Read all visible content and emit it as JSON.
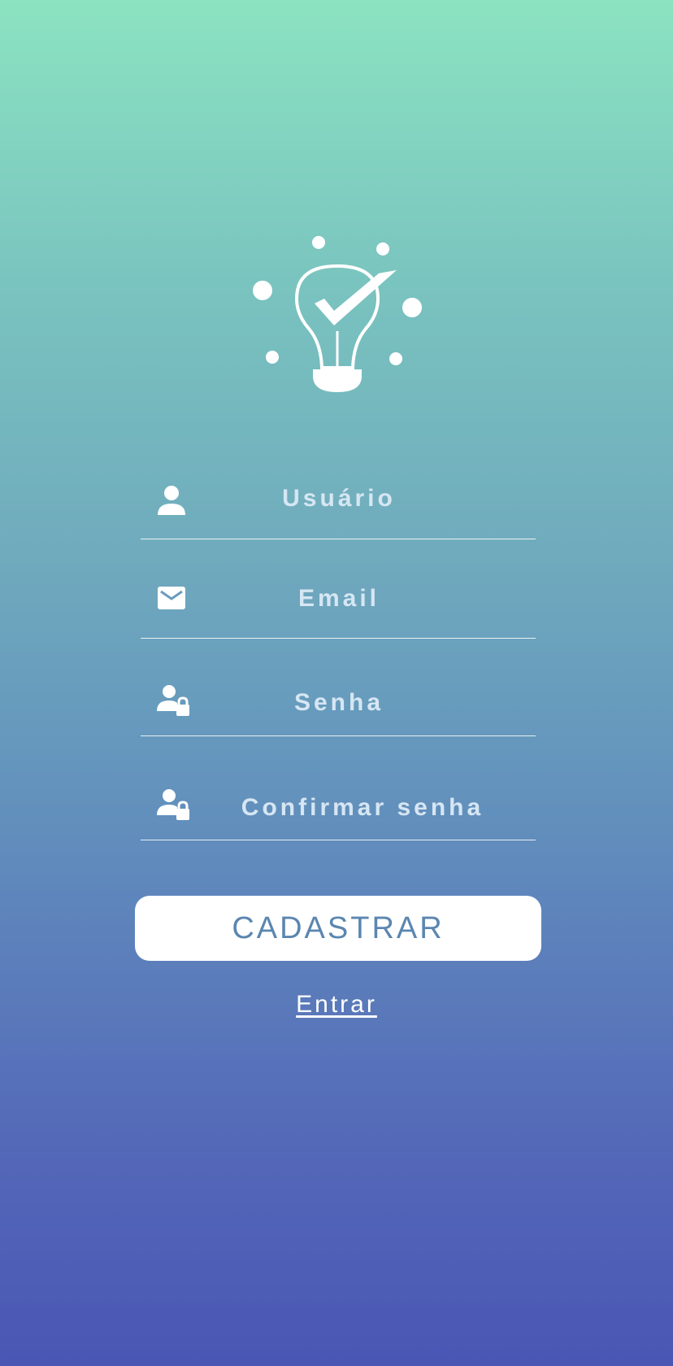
{
  "form": {
    "username": {
      "placeholder": "Usuário",
      "value": ""
    },
    "email": {
      "placeholder": "Email",
      "value": ""
    },
    "password": {
      "placeholder": "Senha",
      "value": ""
    },
    "confirm_password": {
      "placeholder": "Confirmar senha",
      "value": ""
    }
  },
  "actions": {
    "register_label": "CADASTRAR",
    "login_link": "Entrar"
  },
  "icons": {
    "logo": "lightbulb-check-icon",
    "username": "person-icon",
    "email": "envelope-icon",
    "password": "person-lock-icon",
    "confirm_password": "person-lock-icon"
  },
  "colors": {
    "gradient_top": "#8be3c1",
    "gradient_bottom": "#4a56b4",
    "button_background": "#ffffff",
    "button_text": "#5b86b0",
    "placeholder_text": "#d6e6f3"
  }
}
